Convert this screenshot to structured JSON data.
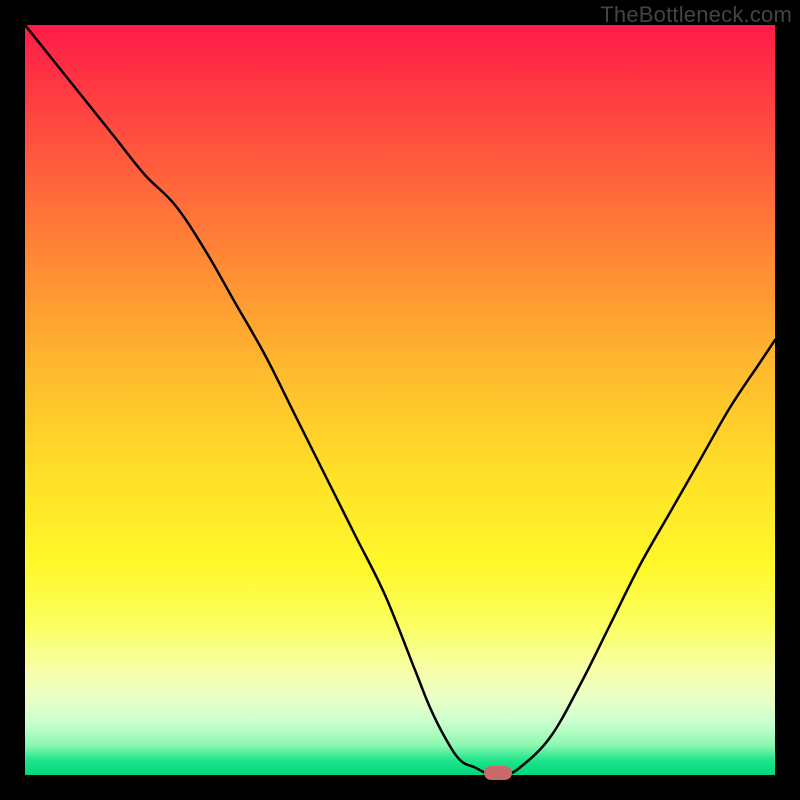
{
  "watermark": "TheBottleneck.com",
  "chart_data": {
    "type": "line",
    "title": "",
    "xlabel": "",
    "ylabel": "",
    "xlim": [
      0,
      100
    ],
    "ylim": [
      0,
      100
    ],
    "grid": false,
    "legend": false,
    "series": [
      {
        "name": "bottleneck-curve",
        "x": [
          0,
          4,
          8,
          12,
          16,
          20,
          24,
          28,
          32,
          36,
          40,
          44,
          48,
          52,
          54,
          56,
          58,
          60,
          62,
          63,
          64,
          66,
          70,
          74,
          78,
          82,
          86,
          90,
          94,
          98,
          100
        ],
        "y": [
          100,
          95,
          90,
          85,
          80,
          76,
          70,
          63,
          56,
          48,
          40,
          32,
          24,
          14,
          9,
          5,
          2,
          1,
          0,
          0,
          0,
          1,
          5,
          12,
          20,
          28,
          35,
          42,
          49,
          55,
          58
        ]
      }
    ],
    "marker": {
      "x": 63,
      "y": 0,
      "color": "#c86a6a"
    },
    "background_gradient": {
      "direction": "vertical",
      "stops": [
        {
          "pos": 0.0,
          "color": "#ff1a48"
        },
        {
          "pos": 0.32,
          "color": "#ff8b35"
        },
        {
          "pos": 0.6,
          "color": "#ffe028"
        },
        {
          "pos": 0.86,
          "color": "#f6ffa8"
        },
        {
          "pos": 1.0,
          "color": "#00d67a"
        }
      ]
    }
  }
}
